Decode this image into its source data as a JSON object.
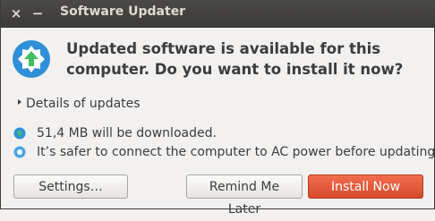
{
  "window": {
    "title": "Software Updater",
    "close_glyph": "×",
    "minimize_glyph": "−"
  },
  "dialog": {
    "icon": "software-updater-icon",
    "heading": "Updated software is available for this computer. Do you want to install it now?",
    "details_label": "Details of updates",
    "download_info": "51,4 MB will be downloaded.",
    "power_info": "It’s safer to connect the computer to AC power before updating."
  },
  "buttons": {
    "settings": "Settings…",
    "remind": "Remind Me Later",
    "install": "Install Now"
  },
  "colors": {
    "titlebar": "#3c3b37",
    "accent": "#e05a37",
    "icon_blue": "#2f8fd8",
    "icon_green": "#3fbf60"
  }
}
